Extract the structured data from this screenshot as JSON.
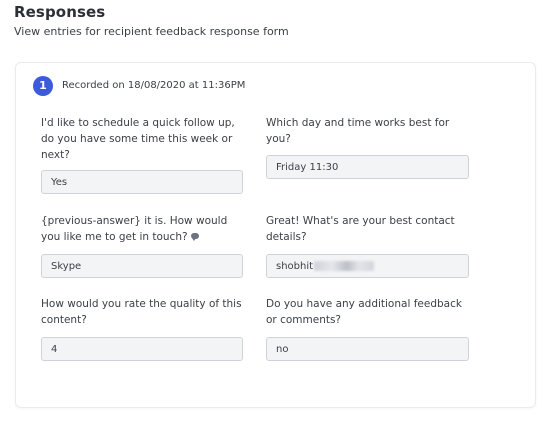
{
  "header": {
    "title": "Responses",
    "subtitle": "View entries for recipient feedback response form"
  },
  "entry": {
    "number": "1",
    "recorded": "Recorded on 18/08/2020 at 11:36PM",
    "items": [
      {
        "question": "I'd like to schedule a quick follow up, do you have some time this week or next?",
        "answer": "Yes"
      },
      {
        "question": "Which day and time works best for you?",
        "answer": "Friday 11:30"
      },
      {
        "question": "{previous-answer} it is. How would you like me to get in touch?",
        "answer": "Skype",
        "icon": "speech-bubble-icon"
      },
      {
        "question": "Great! What's are your best contact details?",
        "answer": "shobhit",
        "answer_note": "remainder of address blurred"
      },
      {
        "question": "How would you rate the quality of this content?",
        "answer": "4"
      },
      {
        "question": "Do you have any additional feedback or comments?",
        "answer": "no"
      }
    ]
  }
}
